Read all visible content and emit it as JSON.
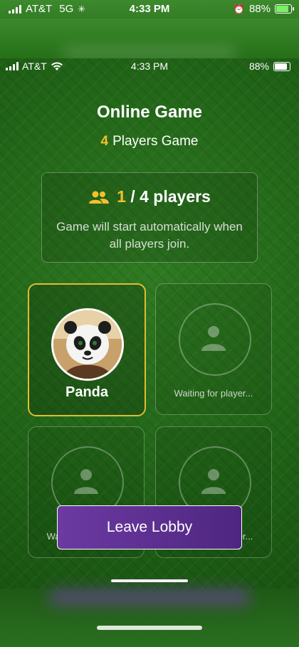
{
  "outer_status": {
    "carrier": "AT&T",
    "network": "5G",
    "time": "4:33 PM",
    "battery": "88%"
  },
  "inner_status": {
    "carrier": "AT&T",
    "time": "4:33 PM",
    "battery": "88%"
  },
  "header": {
    "title": "Online Game",
    "players_number": "4",
    "players_label": "Players Game"
  },
  "info": {
    "current": "1",
    "total_label": "/ 4 players",
    "message": "Game will start automatically when all players join."
  },
  "slots": [
    {
      "name": "Panda"
    },
    {
      "waiting": "Waiting for player..."
    },
    {
      "waiting": "Waiting for player..."
    },
    {
      "waiting": "Waiting for player..."
    }
  ],
  "actions": {
    "leave_label": "Leave Lobby"
  },
  "colors": {
    "accent": "#f3c02c",
    "button": "#5a2d8e",
    "background": "#2f7a22"
  }
}
